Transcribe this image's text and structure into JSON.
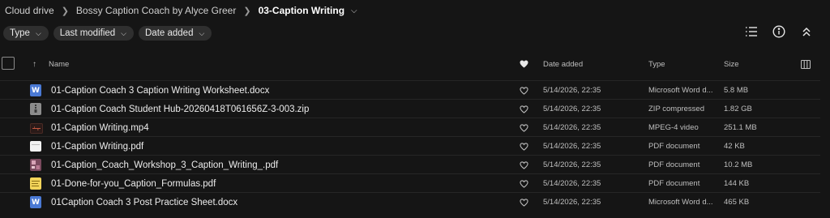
{
  "breadcrumb": {
    "items": [
      "Cloud drive",
      "Bossy Caption Coach by Alyce Greer"
    ],
    "current": "03-Caption Writing"
  },
  "filters": [
    {
      "label": "Type"
    },
    {
      "label": "Last modified"
    },
    {
      "label": "Date added"
    }
  ],
  "toolbar": {
    "icons": [
      "list-view-icon",
      "info-icon",
      "collapse-icon"
    ]
  },
  "columns": {
    "name": "Name",
    "date_added": "Date added",
    "type": "Type",
    "size": "Size"
  },
  "files": [
    {
      "name": "01-Caption Coach 3 Caption Writing Worksheet.docx",
      "date": "5/14/2026, 22:35",
      "type": "Microsoft Word d...",
      "size": "5.8 MB",
      "icon": "word-doc-icon"
    },
    {
      "name": "01-Caption Coach Student Hub-20260418T061656Z-3-003.zip",
      "date": "5/14/2026, 22:35",
      "type": "ZIP compressed",
      "size": "1.82 GB",
      "icon": "zip-icon"
    },
    {
      "name": "01-Caption Writing.mp4",
      "date": "5/14/2026, 22:35",
      "type": "MPEG-4 video",
      "size": "251.1 MB",
      "icon": "video-thumbnail-icon"
    },
    {
      "name": "01-Caption Writing.pdf",
      "date": "5/14/2026, 22:35",
      "type": "PDF document",
      "size": "42 KB",
      "icon": "pdf-icon"
    },
    {
      "name": "01-Caption_Coach_Workshop_3_Caption_Writing_.pdf",
      "date": "5/14/2026, 22:35",
      "type": "PDF document",
      "size": "10.2 MB",
      "icon": "pdf-thumbnail-icon"
    },
    {
      "name": "01-Done-for-you_Caption_Formulas.pdf",
      "date": "5/14/2026, 22:35",
      "type": "PDF document",
      "size": "144 KB",
      "icon": "pdf-thumbnail-icon"
    },
    {
      "name": "01Caption Coach 3 Post Practice Sheet.docx",
      "date": "5/14/2026, 22:35",
      "type": "Microsoft Word d...",
      "size": "465 KB",
      "icon": "word-doc-icon"
    }
  ]
}
